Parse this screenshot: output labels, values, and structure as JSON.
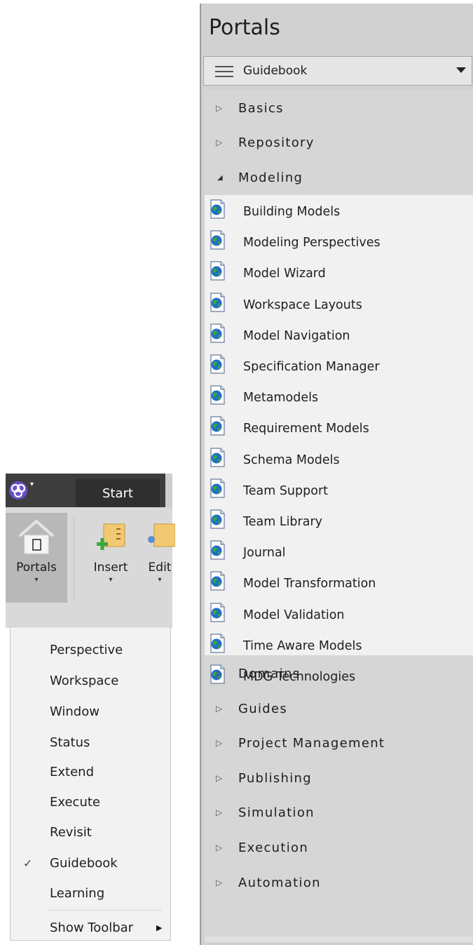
{
  "ribbon": {
    "start_tab": "Start",
    "portals_label": "Portals",
    "insert_label": "Insert",
    "edit_label": "Edit"
  },
  "portals_menu": {
    "items": [
      {
        "label": "Perspective",
        "checked": false
      },
      {
        "label": "Workspace",
        "checked": false
      },
      {
        "label": "Window",
        "checked": false
      },
      {
        "label": "Status",
        "checked": false
      },
      {
        "label": "Extend",
        "checked": false
      },
      {
        "label": "Execute",
        "checked": false
      },
      {
        "label": "Revisit",
        "checked": false
      },
      {
        "label": "Guidebook",
        "checked": true
      },
      {
        "label": "Learning",
        "checked": false
      }
    ],
    "show_toolbar": "Show Toolbar",
    "check_glyph": "✓",
    "submenu_glyph": "▶"
  },
  "panel": {
    "title": "Portals",
    "selector_value": "Guidebook",
    "categories_top": [
      {
        "label": "Basics",
        "expanded": false
      },
      {
        "label": "Repository",
        "expanded": false
      },
      {
        "label": "Modeling",
        "expanded": true
      }
    ],
    "modeling_pages": [
      "Building Models",
      "Modeling Perspectives",
      "Model Wizard",
      "Workspace Layouts",
      "Model Navigation",
      "Specification Manager",
      "Metamodels",
      "Requirement Models",
      "Schema Models",
      "Team Support",
      "Team Library",
      "Journal",
      "Model Transformation",
      "Model Validation",
      "Time Aware Models",
      "MDG Technologies"
    ],
    "categories_bottom": [
      {
        "label": "Domains",
        "expanded": false
      },
      {
        "label": "Guides",
        "expanded": false
      },
      {
        "label": "Project Management",
        "expanded": false
      },
      {
        "label": "Publishing",
        "expanded": false
      },
      {
        "label": "Simulation",
        "expanded": false
      },
      {
        "label": "Execution",
        "expanded": false
      },
      {
        "label": "Automation",
        "expanded": false
      }
    ],
    "collapsed_glyph": "▷",
    "expanded_glyph": "◢"
  },
  "colors": {
    "panel_bg": "#d1d1d1",
    "tree_open_bg": "#f1f1f1",
    "ribbon_dark": "#3d3d3d",
    "menu_bg": "#f2f2f2",
    "page_icon_blue": "#1f6fc9",
    "page_icon_green": "#3aa63a"
  }
}
